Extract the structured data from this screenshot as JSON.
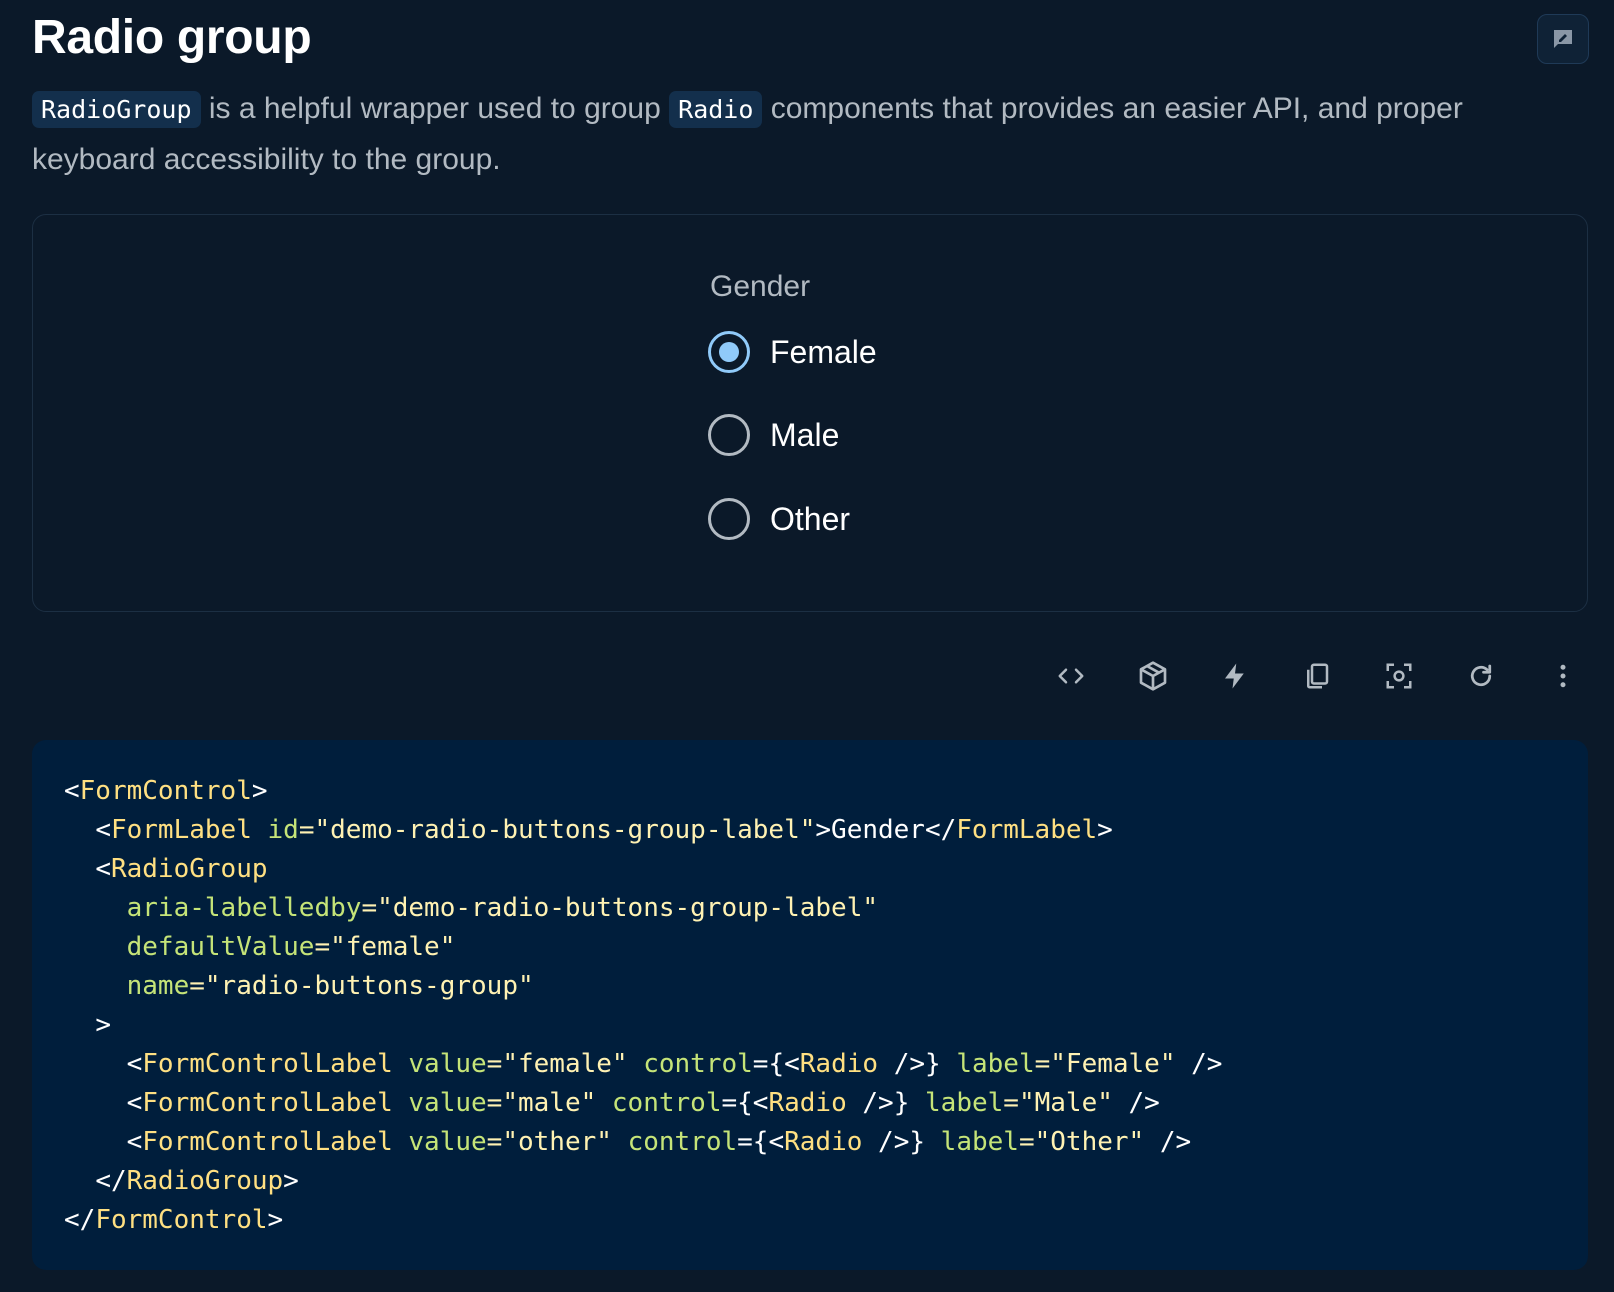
{
  "page": {
    "title": "Radio group",
    "description_code_1": "RadioGroup",
    "description_text_1": " is a helpful wrapper used to group ",
    "description_code_2": "Radio",
    "description_text_2": " components that provides an easier API, and proper keyboard accessibility to the group."
  },
  "demo": {
    "label": "Gender",
    "options": [
      {
        "label": "Female",
        "checked": true
      },
      {
        "label": "Male",
        "checked": false
      },
      {
        "label": "Other",
        "checked": false
      }
    ]
  },
  "toolbar": {
    "icons": [
      "code-icon",
      "codesandbox-icon",
      "stackblitz-icon",
      "copy-icon",
      "focus-icon",
      "reset-icon",
      "more-icon"
    ]
  },
  "code": {
    "t1": "<",
    "t2": "FormControl",
    "t3": ">",
    "t4": "<",
    "t5": "FormLabel",
    "t6": "id",
    "t7": "=\"demo-radio-buttons-group-label\"",
    "t8": ">Gender</",
    "t9": "FormLabel",
    "t10": ">",
    "t11": "<",
    "t12": "RadioGroup",
    "t13": "aria-labelledby",
    "t14": "=\"demo-radio-buttons-group-label\"",
    "t15": "defaultValue",
    "t16": "=\"female\"",
    "t17": "name",
    "t18": "=\"radio-buttons-group\"",
    "t19": ">",
    "t20": "<",
    "t21": "FormControlLabel",
    "t22": "value",
    "t23": "=\"female\"",
    "t24": "control",
    "t25": "={<",
    "t26": "Radio",
    "t27": " />}",
    "t28": "label",
    "t29": "=\"Female\"",
    "t30": " />",
    "t31": "<",
    "t32": "FormControlLabel",
    "t33": "value",
    "t34": "=\"male\"",
    "t35": "control",
    "t36": "={<",
    "t37": "Radio",
    "t38": " />}",
    "t39": "label",
    "t40": "=\"Male\"",
    "t41": " />",
    "t42": "<",
    "t43": "FormControlLabel",
    "t44": "value",
    "t45": "=\"other\"",
    "t46": "control",
    "t47": "={<",
    "t48": "Radio",
    "t49": " />}",
    "t50": "label",
    "t51": "=\"Other\"",
    "t52": " />",
    "t53": "</",
    "t54": "RadioGroup",
    "t55": ">",
    "t56": "</",
    "t57": "FormControl",
    "t58": ">"
  }
}
